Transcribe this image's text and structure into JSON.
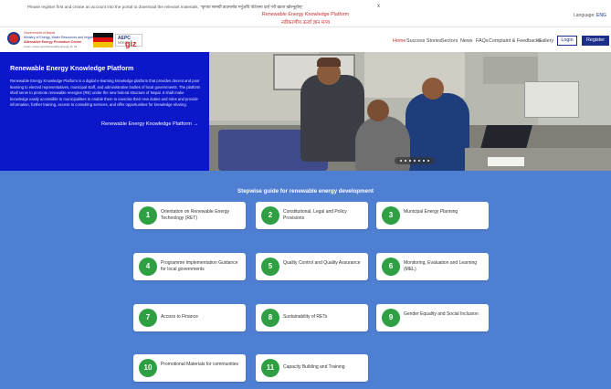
{
  "notice": {
    "text": "Please register first and create an account into the portal to download the relevant materials, \"कृपया सामग्री डाउनलोड गर्नुअघि पोर्टलमा दर्ता गरी खाता खोल्नुहोस्\"",
    "close": "x",
    "center_en": "Renewable Energy Knowledge Platform",
    "center_np": "नवीकरणीय ऊर्जा ज्ञान मञ्च",
    "language_label": "Language:",
    "language_value": "ENG"
  },
  "logos": {
    "gov_line1": "Government of Nepal",
    "gov_line2": "Ministry of Energy, Water Resources and Irrigation",
    "gov_line3": "Alternative Energy Promotion Centre",
    "gov_line4": "Clean, Green and Renewable Energy for All",
    "logo3_line1": "AEPC",
    "logo3_line2": "NRREP",
    "giz": "giz",
    "giz_sub": ""
  },
  "nav": {
    "items": [
      "Home",
      "Success Stories",
      "Sectors",
      "News",
      "FAQs",
      "Complaint & Feedbacks",
      "Gallery"
    ],
    "login": "Login",
    "register": "Register"
  },
  "hero": {
    "title": "Renewable Energy Knowledge Platform",
    "description": "Renewable Energy Knowledge Platform is a digital e-learning knowledge platform that provides decent and poor learning to elected representatives, municipal staff, and administrative bodies of local governments. The platform shall serve to promote renewable energies (RE) under the new federal structure of Nepal. It shall make knowledge easily accessible to municipalities to enable them to exercise their new duties and roles and provide information, further training, access to consulting services, and offer opportunities for knowledge sharing.",
    "link": "Renewable Energy Knowledge Platform →"
  },
  "steps": {
    "title": "Stepwise guide for renewable energy development",
    "items": [
      {
        "num": "1",
        "label": "Orientation on Renewable Energy Technology (RET)"
      },
      {
        "num": "2",
        "label": "Constitutional, Legal and Policy Provisions"
      },
      {
        "num": "3",
        "label": "Municipal Energy Planning"
      },
      {
        "num": "4",
        "label": "Programme Implementation Guidance for local governments"
      },
      {
        "num": "5",
        "label": "Quality Control and Quality Assurance"
      },
      {
        "num": "6",
        "label": "Monitoring, Evaluation and Learning (MEL)"
      },
      {
        "num": "7",
        "label": "Access to Finance"
      },
      {
        "num": "8",
        "label": "Sustainability of RETs"
      },
      {
        "num": "9",
        "label": "Gender Equality and Social Inclusion"
      },
      {
        "num": "10",
        "label": "Promotional Materials for communities"
      },
      {
        "num": "11",
        "label": "Capacity Building and Training"
      }
    ]
  },
  "colors": {
    "brand_blue": "#1b2e8a",
    "hero_blue": "#0b17c8",
    "section_blue": "#4f7fd2",
    "step_green": "#2ea043",
    "accent_red": "#c62828"
  }
}
